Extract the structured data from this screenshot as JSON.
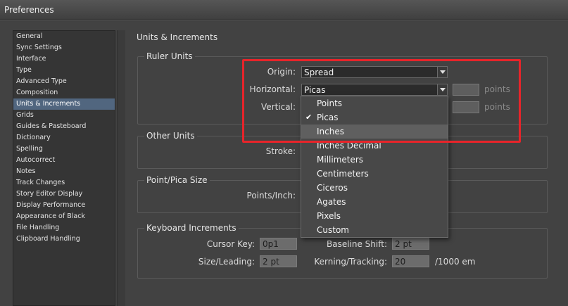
{
  "window": {
    "title": "Preferences"
  },
  "sidebar": {
    "items": [
      {
        "label": "General"
      },
      {
        "label": "Sync Settings"
      },
      {
        "label": "Interface"
      },
      {
        "label": "Type"
      },
      {
        "label": "Advanced Type"
      },
      {
        "label": "Composition"
      },
      {
        "label": "Units & Increments",
        "selected": true
      },
      {
        "label": "Grids"
      },
      {
        "label": "Guides & Pasteboard"
      },
      {
        "label": "Dictionary"
      },
      {
        "label": "Spelling"
      },
      {
        "label": "Autocorrect"
      },
      {
        "label": "Notes"
      },
      {
        "label": "Track Changes"
      },
      {
        "label": "Story Editor Display"
      },
      {
        "label": "Display Performance"
      },
      {
        "label": "Appearance of Black"
      },
      {
        "label": "File Handling"
      },
      {
        "label": "Clipboard Handling"
      }
    ]
  },
  "main": {
    "title": "Units & Increments",
    "ruler_units": {
      "label": "Ruler Units",
      "origin_label": "Origin:",
      "origin_value": "Spread",
      "horizontal_label": "Horizontal:",
      "horizontal_value": "Picas",
      "horizontal_unit": "points",
      "vertical_label": "Vertical:",
      "vertical_unit": "points"
    },
    "other_units": {
      "label": "Other Units",
      "stroke_label": "Stroke:"
    },
    "point_pica": {
      "label": "Point/Pica Size",
      "points_inch_label": "Points/Inch:"
    },
    "keyboard": {
      "label": "Keyboard Increments",
      "cursor_key_label": "Cursor Key:",
      "cursor_key_value": "0p1",
      "size_leading_label": "Size/Leading:",
      "size_leading_value": "2 pt",
      "baseline_shift_label": "Baseline Shift:",
      "baseline_shift_value": "2 pt",
      "kerning_label": "Kerning/Tracking:",
      "kerning_value": "20",
      "kerning_unit": "/1000 em"
    }
  },
  "dropdown": {
    "options": [
      {
        "label": "Points"
      },
      {
        "label": "Picas",
        "checked": true
      },
      {
        "label": "Inches",
        "hover": true
      },
      {
        "label": "Inches Decimal"
      },
      {
        "label": "Millimeters"
      },
      {
        "label": "Centimeters"
      },
      {
        "label": "Ciceros"
      },
      {
        "label": "Agates"
      },
      {
        "label": "Pixels"
      },
      {
        "label": "Custom"
      }
    ],
    "check_glyph": "✔"
  },
  "colors": {
    "highlight": "#e8242a",
    "selection": "#51667f"
  }
}
